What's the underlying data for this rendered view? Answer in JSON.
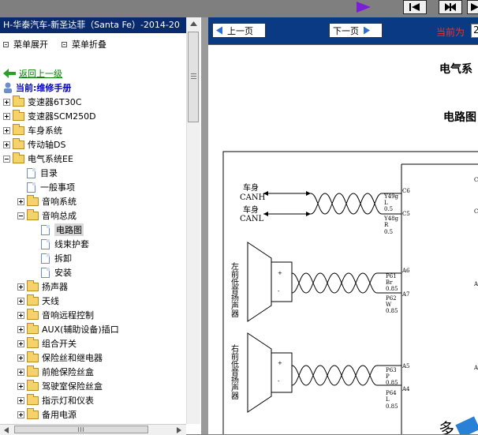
{
  "window": {
    "title": "H-华泰汽车-新圣达菲（Santa Fe）-2014-20"
  },
  "menu": {
    "expand": "菜单展开",
    "collapse": "菜单折叠"
  },
  "tree": {
    "back": "返回上一级",
    "current": "当前:维修手册",
    "items": [
      {
        "label": "变速器6T30C"
      },
      {
        "label": "变速器SCM250D"
      },
      {
        "label": "车身系统"
      },
      {
        "label": "传动轴DS"
      },
      {
        "label": "电气系统EE"
      },
      {
        "label": "目录"
      },
      {
        "label": "一般事项"
      },
      {
        "label": "音响系统"
      },
      {
        "label": "音响总成"
      },
      {
        "label": "电路图"
      },
      {
        "label": "线束护套"
      },
      {
        "label": "拆卸"
      },
      {
        "label": "安装"
      },
      {
        "label": "扬声器"
      },
      {
        "label": "天线"
      },
      {
        "label": "音响远程控制"
      },
      {
        "label": "AUX(辅助设备)插口"
      },
      {
        "label": "组合开关"
      },
      {
        "label": "保险丝和继电器"
      },
      {
        "label": "前舱保险丝盒"
      },
      {
        "label": "驾驶室保险丝盒"
      },
      {
        "label": "指示灯和仪表"
      },
      {
        "label": "备用电源"
      }
    ]
  },
  "nav": {
    "prev": "上一页",
    "next": "下一页",
    "current_label": "当前为",
    "page_value": "2"
  },
  "content": {
    "heading1": "电气系",
    "heading2": "电路图",
    "diagram": {
      "can_h": [
        "车身",
        "CANH"
      ],
      "can_l": [
        "车身",
        "CANL"
      ],
      "wire1": [
        "Y49g",
        "L",
        "0.5"
      ],
      "wire2": [
        "Y48g",
        "R",
        "0.5"
      ],
      "pin_c6": "C6",
      "pin_c5": "C5",
      "left_speaker": "左前低音扬声器",
      "right_speaker": "右前低音扬声器",
      "wire3": [
        "P61",
        "Br",
        "0.85"
      ],
      "wire4": [
        "P62",
        "W",
        "0.85"
      ],
      "pin_a6": "A6",
      "pin_a7": "A7",
      "wire5": [
        "P63",
        "P",
        "0.85"
      ],
      "wire6": [
        "P64",
        "L",
        "0.85"
      ],
      "pin_a5": "A5",
      "pin_a4": "A4",
      "watermark": "多"
    }
  },
  "colors": {
    "title_bar": "#0a2a6e",
    "nav_bar": "#0a3a84",
    "current_label": "#ff2a2a",
    "back_link": "#008000",
    "watermark": "#2a7fd6"
  }
}
